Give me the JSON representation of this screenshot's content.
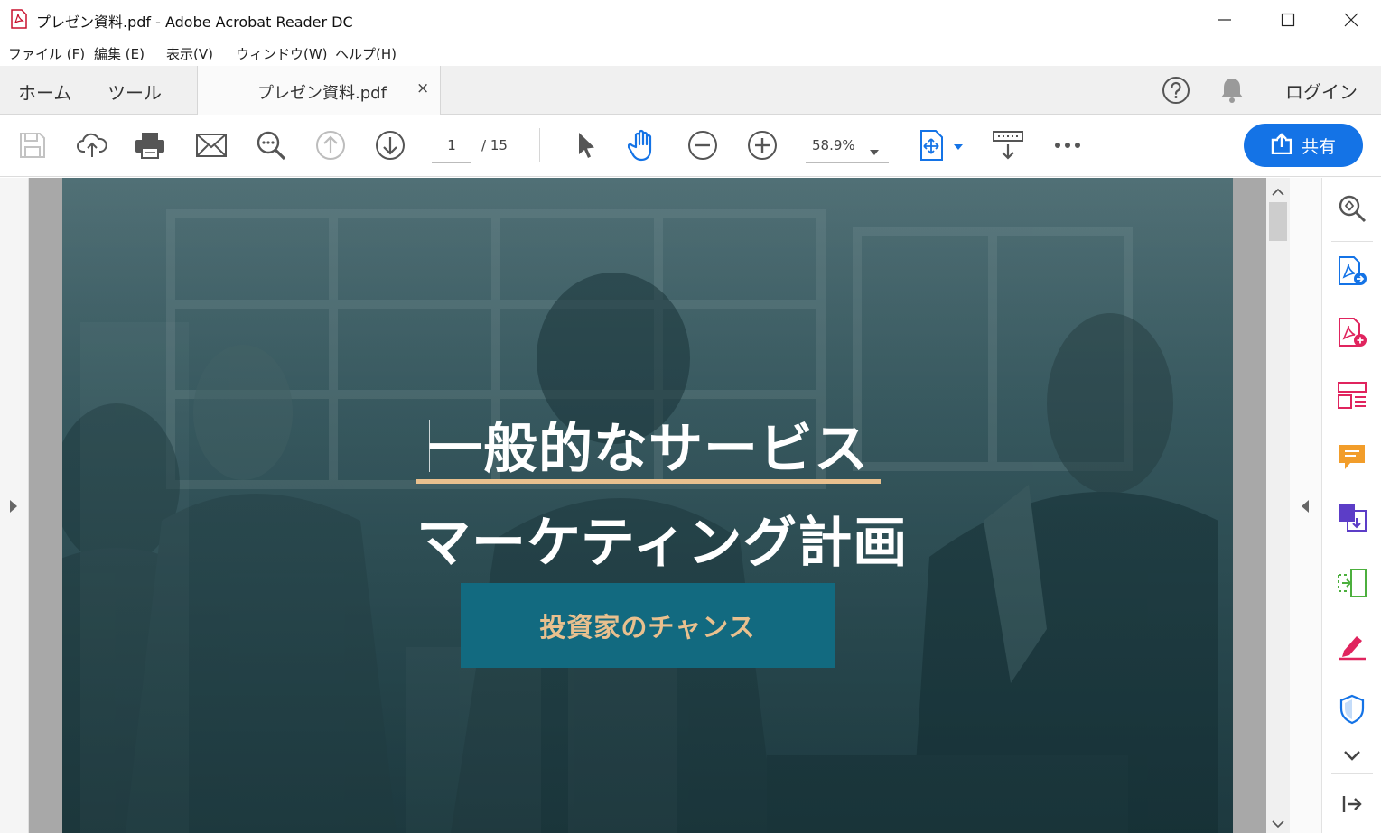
{
  "window": {
    "title": "プレゼン資料.pdf - Adobe Acrobat Reader DC"
  },
  "menu": [
    "ファイル (F)",
    "編集 (E)",
    "表示(V)",
    "ウィンドウ(W)",
    "ヘルプ(H)"
  ],
  "tabs": {
    "home": "ホーム",
    "tools": "ツール",
    "document": "プレゼン資料.pdf",
    "close_glyph": "×",
    "login": "ログイン"
  },
  "toolbar": {
    "page_current": "1",
    "page_total": "/  15",
    "zoom": "58.9%",
    "share": "共有"
  },
  "document": {
    "headline": "一般的なサービス",
    "subheadline": "マーケティング計画",
    "cta": "投資家のチャンス"
  },
  "colors": {
    "accent_blue": "#1473e6",
    "cta_background": "#126a80",
    "gold": "#e9c08e"
  }
}
